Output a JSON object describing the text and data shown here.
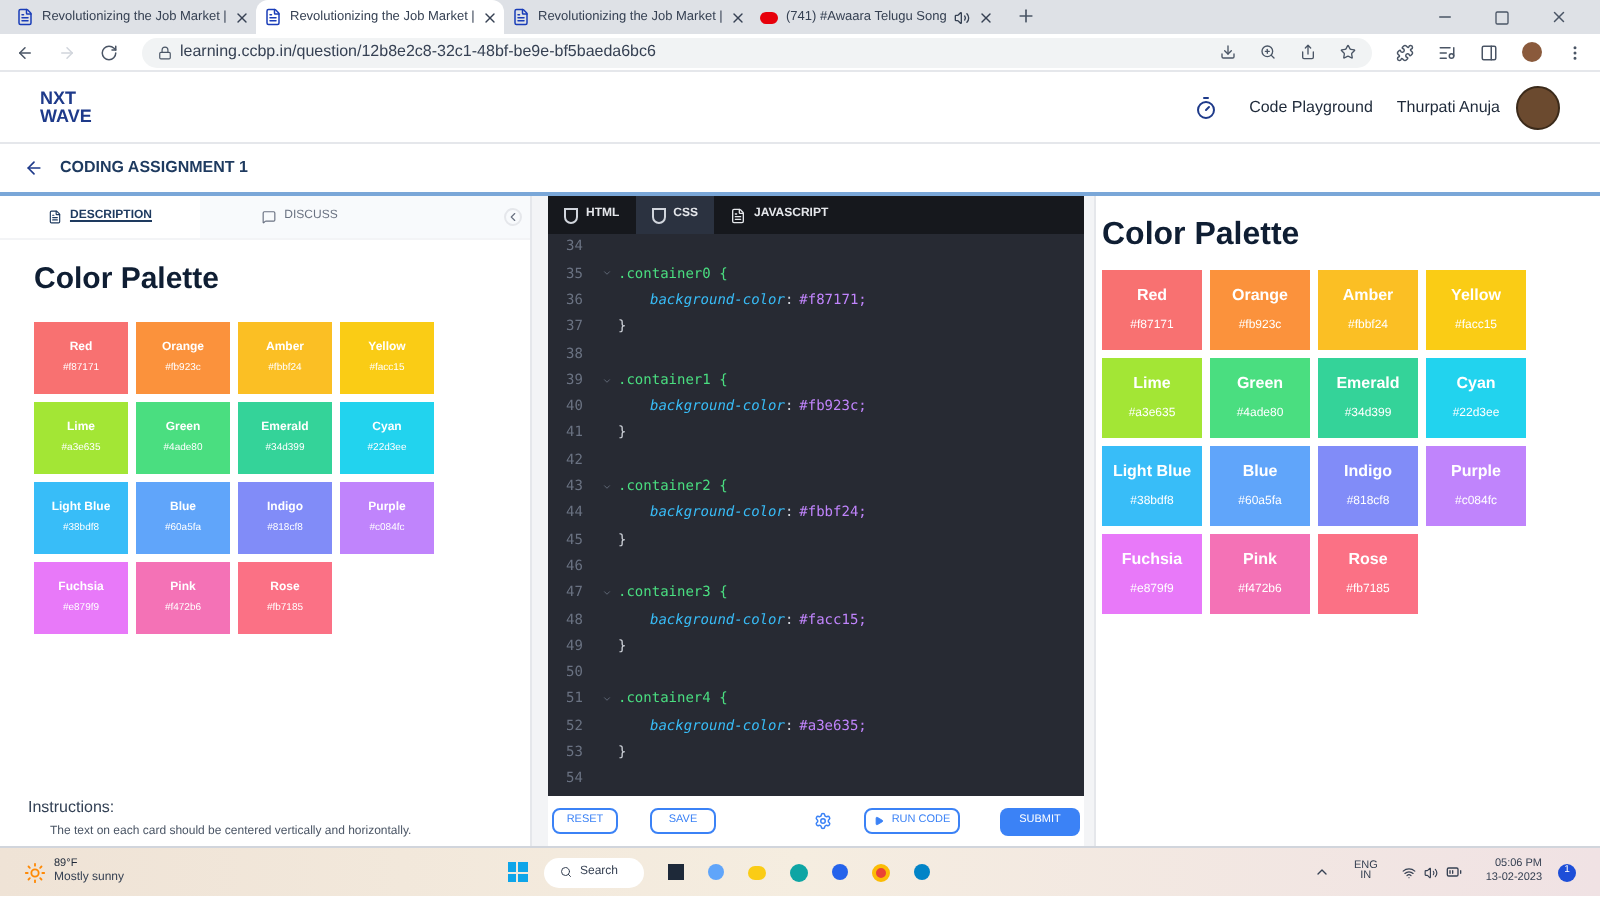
{
  "browser": {
    "tabs": [
      {
        "title": "Revolutionizing the Job Market |",
        "selected": false,
        "kind": "page"
      },
      {
        "title": "Revolutionizing the Job Market |",
        "selected": true,
        "kind": "page"
      },
      {
        "title": "Revolutionizing the Job Market |",
        "selected": false,
        "kind": "page"
      },
      {
        "title": "(741) #Awaara Telugu Song",
        "selected": false,
        "kind": "video"
      }
    ],
    "url": "learning.ccbp.in/question/12b8e2c8-32c1-48bf-be9e-bf5baeda6bc6"
  },
  "header": {
    "logo_top": "NXT",
    "logo_bottom": "WAVE",
    "nav_link": "Code Playground",
    "user_name": "Thurpati Anuja"
  },
  "assignment": {
    "title": "CODING ASSIGNMENT 1"
  },
  "description": {
    "tabs": [
      {
        "label": "DESCRIPTION",
        "selected": true
      },
      {
        "label": "DISCUSS",
        "selected": false
      }
    ],
    "title": "Color Palette",
    "cards": [
      {
        "name": "Red",
        "hex": "#f87171",
        "color": "#f87171"
      },
      {
        "name": "Orange",
        "hex": "#fb923c",
        "color": "#fb923c"
      },
      {
        "name": "Amber",
        "hex": "#fbbf24",
        "color": "#fbbf24"
      },
      {
        "name": "Yellow",
        "hex": "#facc15",
        "color": "#facc15"
      },
      {
        "name": "Lime",
        "hex": "#a3e635",
        "color": "#a3e635"
      },
      {
        "name": "Green",
        "hex": "#4ade80",
        "color": "#4ade80"
      },
      {
        "name": "Emerald",
        "hex": "#34d399",
        "color": "#34d399"
      },
      {
        "name": "Cyan",
        "hex": "#22d3ee",
        "color": "#22d3ee"
      },
      {
        "name": "Light Blue",
        "hex": "#38bdf8",
        "color": "#38bdf8"
      },
      {
        "name": "Blue",
        "hex": "#60a5fa",
        "color": "#60a5fa"
      },
      {
        "name": "Indigo",
        "hex": "#818cf8",
        "color": "#818cf8"
      },
      {
        "name": "Purple",
        "hex": "#c084fc",
        "color": "#c084fc"
      },
      {
        "name": "Fuchsia",
        "hex": "#e879f9",
        "color": "#e879f9"
      },
      {
        "name": "Pink",
        "hex": "#f472b6",
        "color": "#f472b6"
      },
      {
        "name": "Rose",
        "hex": "#fb7185",
        "color": "#fb7185"
      }
    ],
    "instructions_heading": "Instructions:",
    "instruction": "The text on each card should be centered vertically and horizontally."
  },
  "editor": {
    "tabs": [
      {
        "label": "HTML",
        "selected": false,
        "kind": "html"
      },
      {
        "label": "CSS",
        "selected": true,
        "kind": "css"
      },
      {
        "label": "JAVASCRIPT",
        "selected": false,
        "kind": "js"
      }
    ],
    "lines": [
      {
        "number": "34",
        "kind": "blank"
      },
      {
        "number": "35",
        "kind": "selector",
        "text": ".container0 {"
      },
      {
        "number": "36",
        "kind": "declaration",
        "property": "background-color",
        "separator": ":",
        "value": "#f87171;"
      },
      {
        "number": "37",
        "kind": "close",
        "text": "}"
      },
      {
        "number": "38",
        "kind": "blank"
      },
      {
        "number": "39",
        "kind": "selector",
        "text": ".container1 {"
      },
      {
        "number": "40",
        "kind": "declaration",
        "property": "background-color",
        "separator": ":",
        "value": "#fb923c;"
      },
      {
        "number": "41",
        "kind": "close",
        "text": "}"
      },
      {
        "number": "42",
        "kind": "blank"
      },
      {
        "number": "43",
        "kind": "selector",
        "text": ".container2 {"
      },
      {
        "number": "44",
        "kind": "declaration",
        "property": "background-color",
        "separator": ":",
        "value": "#fbbf24;"
      },
      {
        "number": "45",
        "kind": "close",
        "text": "}"
      },
      {
        "number": "46",
        "kind": "blank"
      },
      {
        "number": "47",
        "kind": "selector",
        "text": ".container3 {"
      },
      {
        "number": "48",
        "kind": "declaration",
        "property": "background-color",
        "separator": ":",
        "value": "#facc15;"
      },
      {
        "number": "49",
        "kind": "close",
        "text": "}"
      },
      {
        "number": "50",
        "kind": "blank"
      },
      {
        "number": "51",
        "kind": "selector",
        "text": ".container4 {"
      },
      {
        "number": "52",
        "kind": "declaration",
        "property": "background-color",
        "separator": ":",
        "value": "#a3e635;"
      },
      {
        "number": "53",
        "kind": "close",
        "text": "}"
      },
      {
        "number": "54",
        "kind": "blank"
      }
    ],
    "buttons": {
      "reset": "RESET",
      "save": "SAVE",
      "run": "RUN CODE",
      "submit": "SUBMIT"
    }
  },
  "preview": {
    "title": "Color Palette",
    "cards": [
      {
        "name": "Red",
        "hex": "#f87171",
        "color": "#f87171"
      },
      {
        "name": "Orange",
        "hex": "#fb923c",
        "color": "#fb923c"
      },
      {
        "name": "Amber",
        "hex": "#fbbf24",
        "color": "#fbbf24"
      },
      {
        "name": "Yellow",
        "hex": "#facc15",
        "color": "#facc15"
      },
      {
        "name": "Lime",
        "hex": "#a3e635",
        "color": "#a3e635"
      },
      {
        "name": "Green",
        "hex": "#4ade80",
        "color": "#4ade80"
      },
      {
        "name": "Emerald",
        "hex": "#34d399",
        "color": "#34d399"
      },
      {
        "name": "Cyan",
        "hex": "#22d3ee",
        "color": "#22d3ee"
      },
      {
        "name": "Light Blue",
        "hex": "#38bdf8",
        "color": "#38bdf8"
      },
      {
        "name": "Blue",
        "hex": "#60a5fa",
        "color": "#60a5fa"
      },
      {
        "name": "Indigo",
        "hex": "#818cf8",
        "color": "#818cf8"
      },
      {
        "name": "Purple",
        "hex": "#c084fc",
        "color": "#c084fc"
      },
      {
        "name": "Fuchsia",
        "hex": "#e879f9",
        "color": "#e879f9"
      },
      {
        "name": "Pink",
        "hex": "#f472b6",
        "color": "#f472b6"
      },
      {
        "name": "Rose",
        "hex": "#fb7185",
        "color": "#fb7185"
      }
    ]
  },
  "taskbar": {
    "temperature": "89°F",
    "weather": "Mostly sunny",
    "search": "Search",
    "lang_top": "ENG",
    "lang_bottom": "IN",
    "time": "05:06 PM",
    "date": "13-02-2023",
    "notifications": "1"
  }
}
